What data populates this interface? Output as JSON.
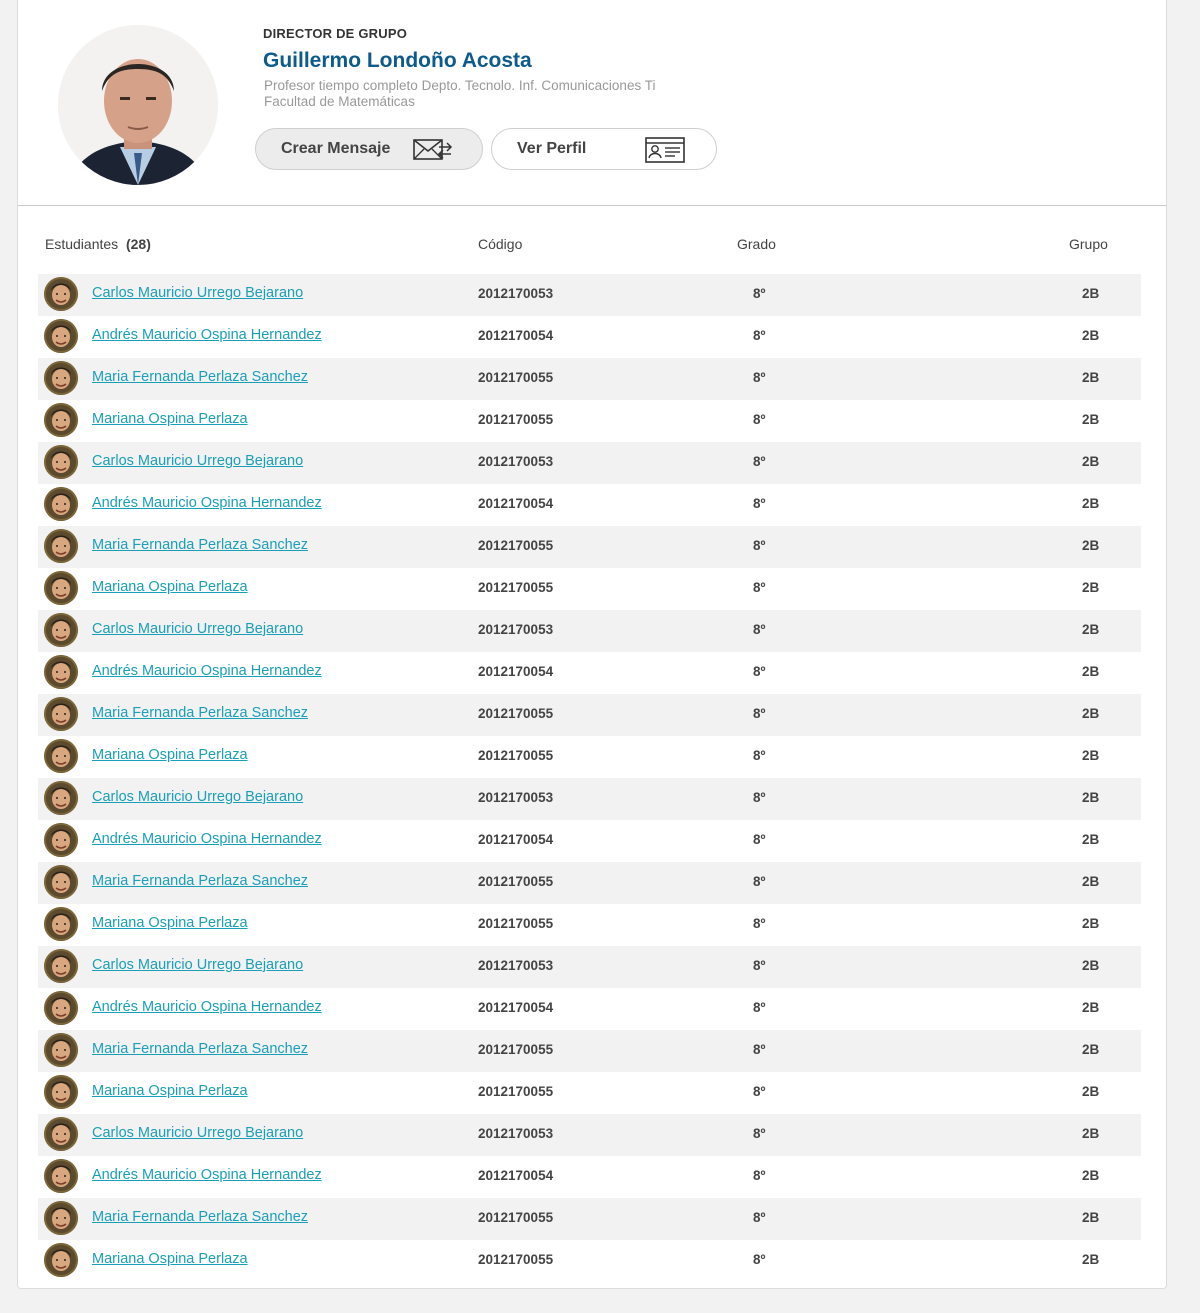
{
  "director": {
    "label": "DIRECTOR DE GRUPO",
    "name": "Guillermo Londoño Acosta",
    "position": "Profesor tiempo completo Depto. Tecnolo. Inf. Comunicaciones Ti",
    "faculty": "Facultad de Matemáticas",
    "message_button": "Crear Mensaje",
    "profile_button": "Ver Perfil"
  },
  "table": {
    "students_label": "Estudiantes",
    "students_count": "(28)",
    "col_code": "Código",
    "col_grade": "Grado",
    "col_group": "Grupo",
    "rows": [
      {
        "name": "Carlos Mauricio Urrego Bejarano",
        "code": "2012170053",
        "grade": "8º",
        "group": "2B"
      },
      {
        "name": "Andrés Mauricio Ospina Hernandez",
        "code": "2012170054",
        "grade": "8º",
        "group": "2B"
      },
      {
        "name": "Maria Fernanda Perlaza Sanchez",
        "code": "2012170055",
        "grade": "8º",
        "group": "2B"
      },
      {
        "name": "Mariana Ospina Perlaza",
        "code": "2012170055",
        "grade": "8º",
        "group": "2B"
      },
      {
        "name": "Carlos Mauricio Urrego Bejarano",
        "code": "2012170053",
        "grade": "8º",
        "group": "2B"
      },
      {
        "name": "Andrés Mauricio Ospina Hernandez",
        "code": "2012170054",
        "grade": "8º",
        "group": "2B"
      },
      {
        "name": "Maria Fernanda Perlaza Sanchez",
        "code": "2012170055",
        "grade": "8º",
        "group": "2B"
      },
      {
        "name": "Mariana Ospina Perlaza",
        "code": "2012170055",
        "grade": "8º",
        "group": "2B"
      },
      {
        "name": "Carlos Mauricio Urrego Bejarano",
        "code": "2012170053",
        "grade": "8º",
        "group": "2B"
      },
      {
        "name": "Andrés Mauricio Ospina Hernandez",
        "code": "2012170054",
        "grade": "8º",
        "group": "2B"
      },
      {
        "name": "Maria Fernanda Perlaza Sanchez",
        "code": "2012170055",
        "grade": "8º",
        "group": "2B"
      },
      {
        "name": "Mariana Ospina Perlaza",
        "code": "2012170055",
        "grade": "8º",
        "group": "2B"
      },
      {
        "name": "Carlos Mauricio Urrego Bejarano",
        "code": "2012170053",
        "grade": "8º",
        "group": "2B"
      },
      {
        "name": "Andrés Mauricio Ospina Hernandez",
        "code": "2012170054",
        "grade": "8º",
        "group": "2B"
      },
      {
        "name": "Maria Fernanda Perlaza Sanchez",
        "code": "2012170055",
        "grade": "8º",
        "group": "2B"
      },
      {
        "name": "Mariana Ospina Perlaza",
        "code": "2012170055",
        "grade": "8º",
        "group": "2B"
      },
      {
        "name": "Carlos Mauricio Urrego Bejarano",
        "code": "2012170053",
        "grade": "8º",
        "group": "2B"
      },
      {
        "name": "Andrés Mauricio Ospina Hernandez",
        "code": "2012170054",
        "grade": "8º",
        "group": "2B"
      },
      {
        "name": "Maria Fernanda Perlaza Sanchez",
        "code": "2012170055",
        "grade": "8º",
        "group": "2B"
      },
      {
        "name": "Mariana Ospina Perlaza",
        "code": "2012170055",
        "grade": "8º",
        "group": "2B"
      },
      {
        "name": "Carlos Mauricio Urrego Bejarano",
        "code": "2012170053",
        "grade": "8º",
        "group": "2B"
      },
      {
        "name": "Andrés Mauricio Ospina Hernandez",
        "code": "2012170054",
        "grade": "8º",
        "group": "2B"
      },
      {
        "name": "Maria Fernanda Perlaza Sanchez",
        "code": "2012170055",
        "grade": "8º",
        "group": "2B"
      },
      {
        "name": "Mariana Ospina Perlaza",
        "code": "2012170055",
        "grade": "8º",
        "group": "2B"
      }
    ]
  },
  "colors": {
    "accent_name": "#0d5a8c",
    "link": "#1a9fb8",
    "row_alt": "#f2f2f2"
  },
  "icons": {
    "message": "envelope-arrows-icon",
    "profile": "id-card-icon",
    "avatar": "student-avatar-icon"
  }
}
